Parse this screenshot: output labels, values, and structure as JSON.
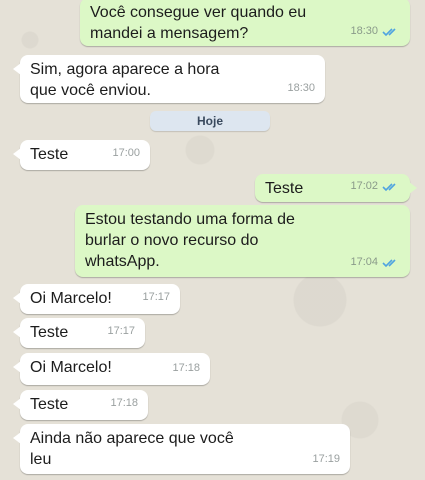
{
  "date_divider": "Hoje",
  "messages": [
    {
      "dir": "out",
      "text": "Você consegue ver quando eu\nmandei a mensagem?",
      "time": "18:30",
      "read": true
    },
    {
      "dir": "in",
      "text": "Sim, agora aparece a hora\nque você enviou.",
      "time": "18:30"
    },
    {
      "dir": "in",
      "text": "Teste",
      "time": "17:00"
    },
    {
      "dir": "out",
      "text": "Teste",
      "time": "17:02",
      "read": true
    },
    {
      "dir": "out",
      "text": "Estou testando uma forma de\nburlar o novo recurso do\nwhatsApp.",
      "time": "17:04",
      "read": true
    },
    {
      "dir": "in",
      "text": "Oi Marcelo!",
      "time": "17:17"
    },
    {
      "dir": "in",
      "text": "Teste",
      "time": "17:17"
    },
    {
      "dir": "in",
      "text": "Oi Marcelo!",
      "time": "17:18"
    },
    {
      "dir": "in",
      "text": "Teste",
      "time": "17:18"
    },
    {
      "dir": "in",
      "text": "Ainda não aparece que você\nleu",
      "time": "17:19"
    }
  ],
  "colors": {
    "incoming": "#ffffff",
    "outgoing": "#dcf8c6",
    "read_ticks": "#4fa3e0"
  }
}
